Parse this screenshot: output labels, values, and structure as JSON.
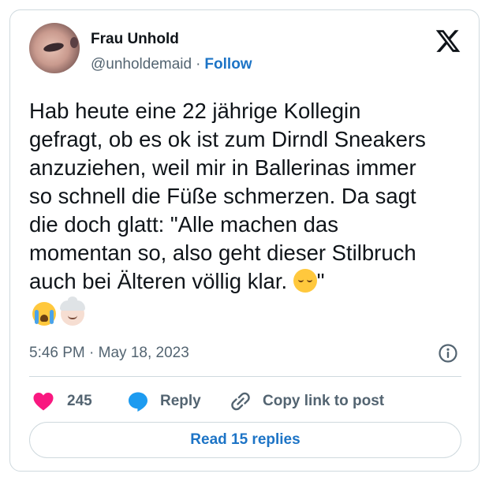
{
  "author": {
    "name": "Frau Unhold",
    "handle": "@unholdemaid",
    "separator": "·",
    "follow_label": "Follow"
  },
  "brand": {
    "logo_icon": "x-logo-icon"
  },
  "tweet": {
    "text": "Hab heute eine 22 jährige Kollegin\ngefragt, ob es ok ist zum Dirndl Sneakers\nanzuziehen, weil mir in Ballerinas immer\nso schnell die Füße schmerzen. Da sagt\ndie doch glatt: \"Alle machen das\nmomentan so, also geht dieser Stilbruch\nauch bei Älteren völlig klar. ",
    "text_end": "\"",
    "inline_emoji": "relieved-face-emoji",
    "trailing_emojis": [
      "loudly-crying-face-emoji",
      "older-woman-emoji"
    ],
    "timestamp": "5:46 PM · May 18, 2023"
  },
  "actions": {
    "like_count": "245",
    "reply_label": "Reply",
    "copy_link_label": "Copy link to post"
  },
  "read_replies_label": "Read 15 replies",
  "colors": {
    "accent": "#1d74c6",
    "like": "#f91880",
    "reply": "#1d9bf0",
    "muted": "#536471",
    "border": "#cfd9de"
  }
}
